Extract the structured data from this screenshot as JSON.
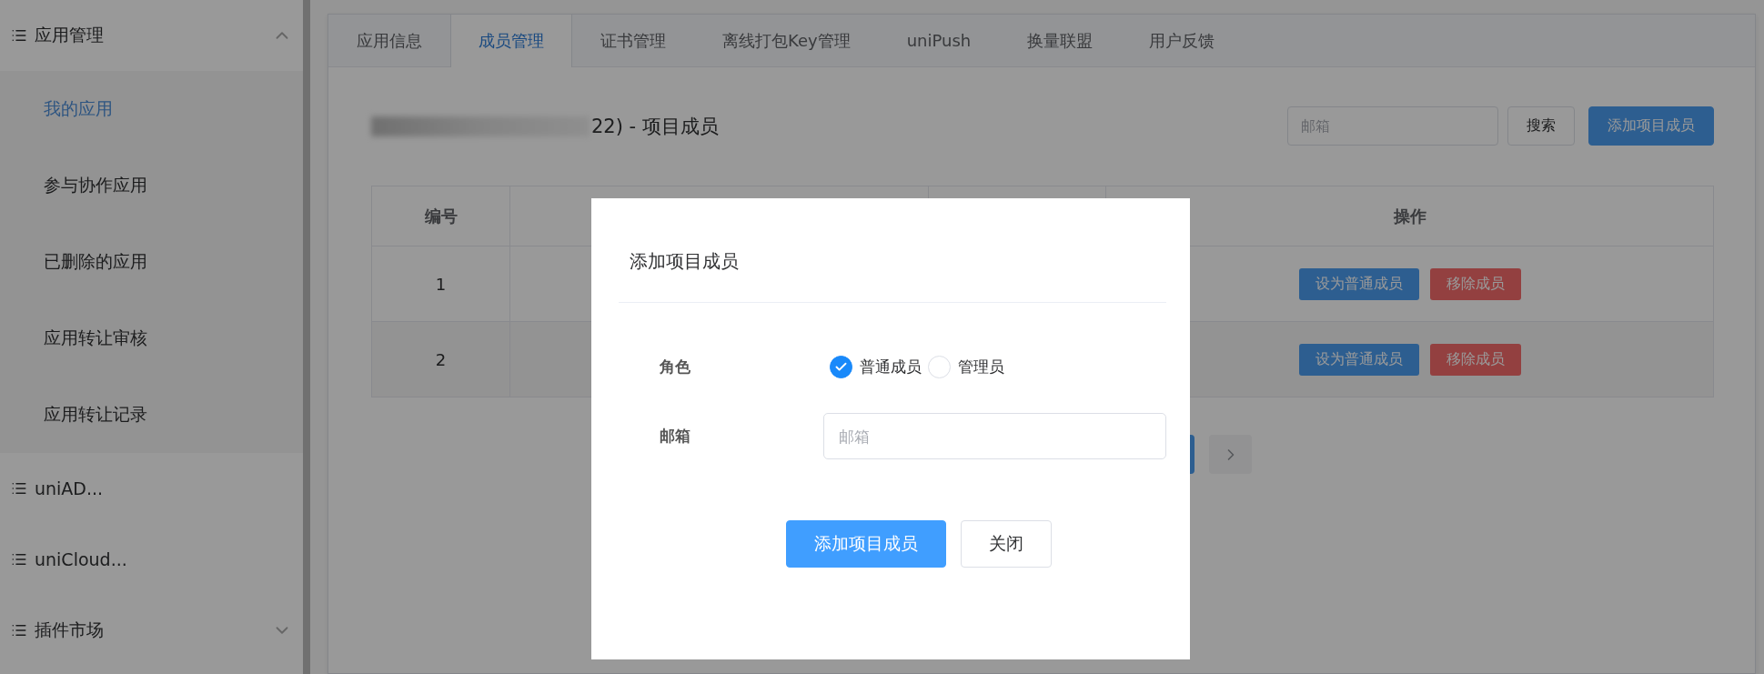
{
  "sidebar": {
    "groups": [
      {
        "label": "应用管理",
        "expanded": true,
        "children": [
          {
            "label": "我的应用",
            "selected": true
          },
          {
            "label": "参与协作应用",
            "selected": false
          },
          {
            "label": "已删除的应用",
            "selected": false
          },
          {
            "label": "应用转让审核",
            "selected": false
          },
          {
            "label": "应用转让记录",
            "selected": false
          }
        ]
      },
      {
        "label": "uniAD..."
      },
      {
        "label": "uniCloud..."
      },
      {
        "label": "插件市场",
        "expanded": false
      }
    ]
  },
  "tabs": [
    {
      "label": "应用信息",
      "selected": false
    },
    {
      "label": "成员管理",
      "selected": true
    },
    {
      "label": "证书管理",
      "selected": false
    },
    {
      "label": "离线打包Key管理",
      "selected": false
    },
    {
      "label": "uniPush",
      "selected": false
    },
    {
      "label": "换量联盟",
      "selected": false
    },
    {
      "label": "用户反馈",
      "selected": false
    }
  ],
  "header": {
    "title": "22) - 项目成员",
    "search": {
      "placeholder": "邮箱"
    },
    "search_button": "搜索",
    "add_button": "添加项目成员"
  },
  "table": {
    "columns": [
      "编号",
      "操作"
    ],
    "rows": [
      {
        "number": "1",
        "actions": [
          {
            "kind": "primary",
            "label": "设为普通成员"
          },
          {
            "kind": "danger",
            "label": "移除成员"
          }
        ]
      },
      {
        "number": "2",
        "actions": [
          {
            "kind": "primary",
            "label": "设为普通成员"
          },
          {
            "kind": "danger",
            "label": "移除成员"
          }
        ]
      }
    ]
  },
  "dialog": {
    "title": "添加项目成员",
    "fields": [
      {
        "kind": "radio",
        "label": "角色",
        "options": [
          {
            "label": "普通成员",
            "selected": true
          },
          {
            "label": "管理员",
            "selected": false
          }
        ]
      },
      {
        "kind": "input",
        "label": "邮箱",
        "placeholder": "邮箱"
      }
    ],
    "buttons": [
      {
        "kind": "primary",
        "label": "添加项目成员"
      },
      {
        "kind": "default",
        "label": "关闭"
      }
    ]
  }
}
